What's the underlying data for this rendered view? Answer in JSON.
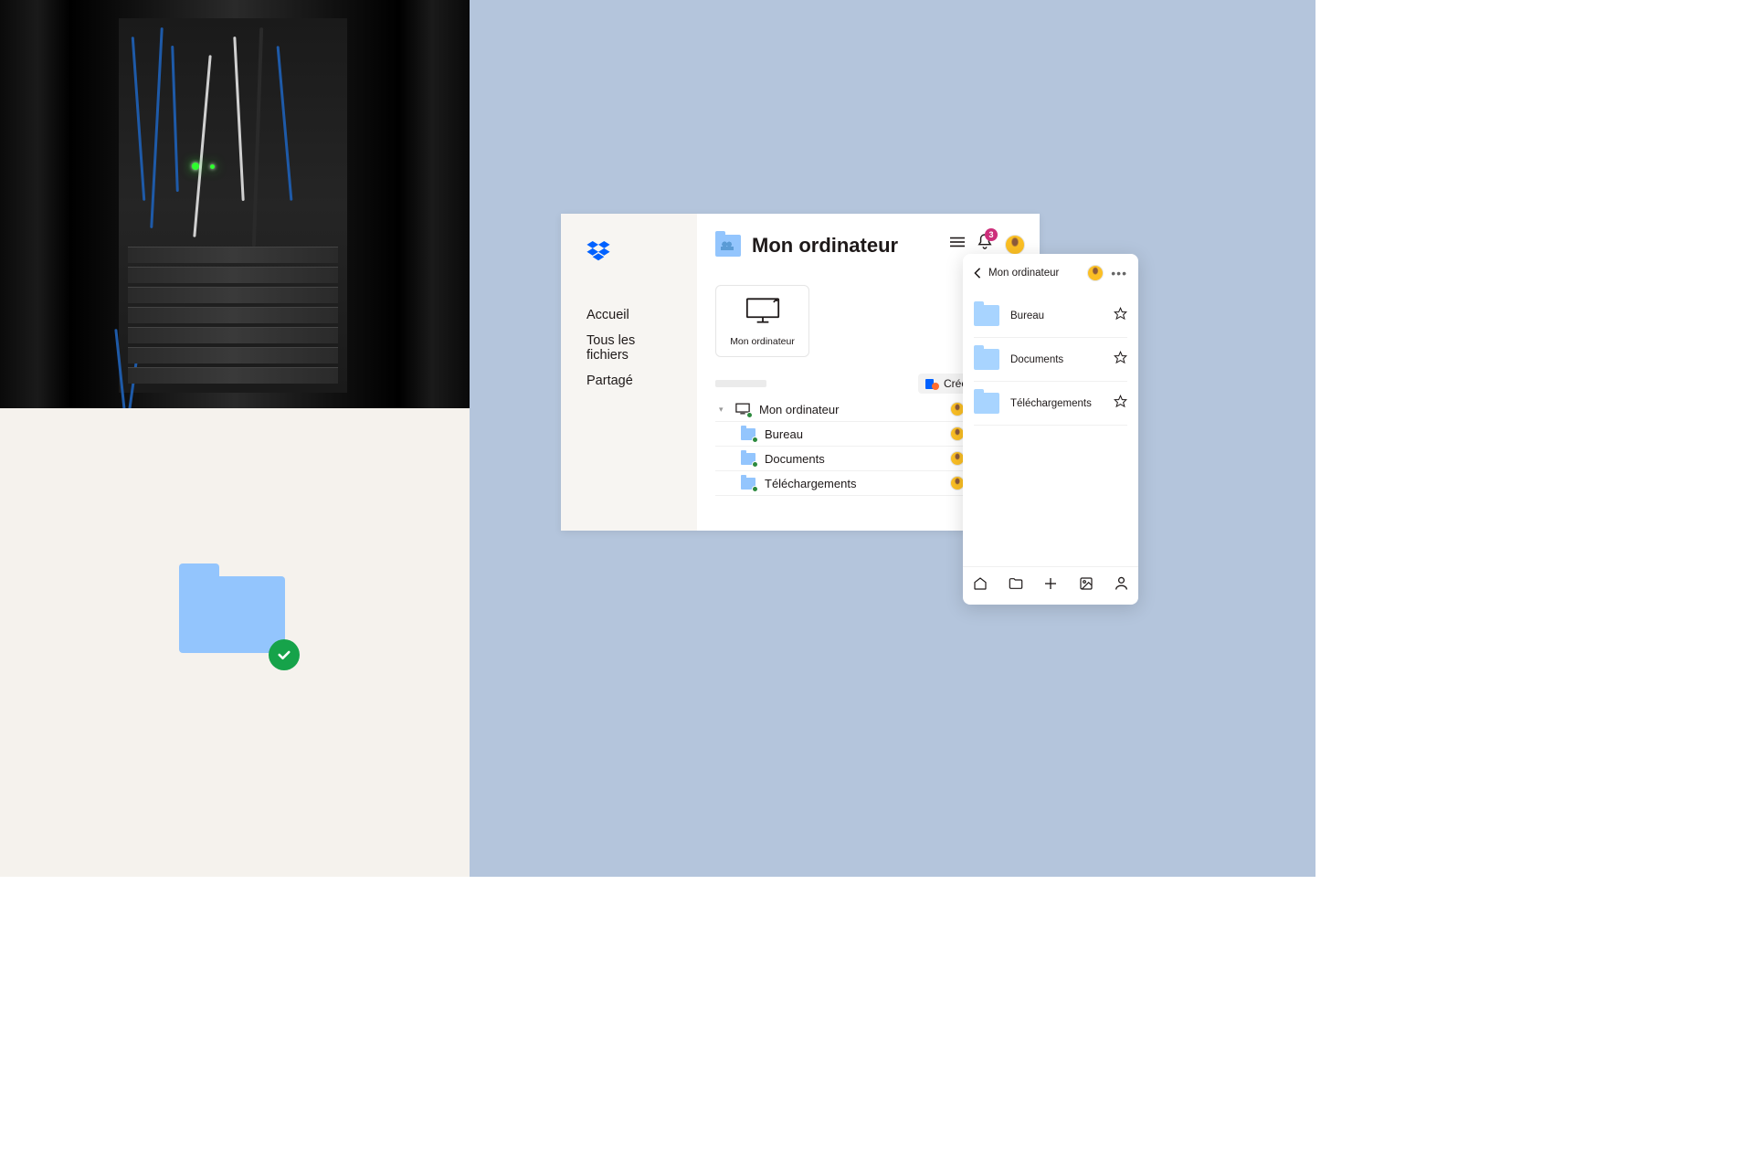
{
  "desktop": {
    "title": "Mon ordinateur",
    "nav": {
      "home": "Accueil",
      "all_files": "Tous les fichiers",
      "shared": "Partagé"
    },
    "computer_card": "Mon ordinateur",
    "create_button": "Créer",
    "notification_count": "3",
    "files": {
      "root": "Mon ordinateur",
      "desktop": "Bureau",
      "documents": "Documents",
      "downloads": "Téléchargements"
    }
  },
  "mobile": {
    "title": "Mon ordinateur",
    "items": {
      "desktop": "Bureau",
      "documents": "Documents",
      "downloads": "Téléchargements"
    }
  }
}
